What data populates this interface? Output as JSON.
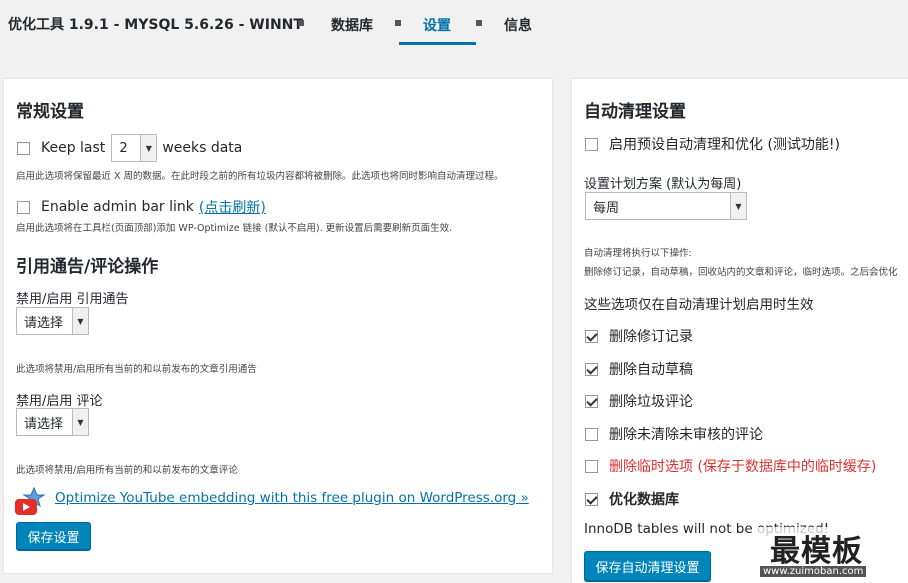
{
  "header": {
    "app_title": "优化工具 1.9.1 - MYSQL 5.6.26 - WINNT",
    "tabs": [
      {
        "label": "数据库",
        "active": false
      },
      {
        "label": "设置",
        "active": true
      },
      {
        "label": "信息",
        "active": false
      }
    ]
  },
  "general": {
    "title": "常规设置",
    "keep_last_label": "Keep last",
    "keep_last_value": "2",
    "weeks_label": "weeks data",
    "keep_last_desc": "启用此选项将保留最近 X 周的数据。在此时段之前的所有垃圾内容都将被删除。此选项也将同时影响自动清理过程。",
    "admin_bar_label": "Enable admin bar link",
    "admin_bar_link": "(点击刷新)",
    "admin_bar_desc": "启用此选项将在工具栏(页面顶部)添加 WP-Optimize 链接 (默认不启用). 更新设置后需要刷新页面生效."
  },
  "trackbacks": {
    "title": "引用通告/评论操作",
    "trackback_label": "禁用/启用 引用通告",
    "trackback_select": "请选择",
    "trackback_desc": "此选项将禁用/启用所有当前的和以前发布的文章引用通告",
    "comments_label": "禁用/启用 评论",
    "comments_select": "请选择",
    "comments_desc": "此选项将禁用/启用所有当前的和以前发布的文章评论",
    "youtube_link": "Optimize YouTube embedding with this free plugin on WordPress.org »",
    "save_button": "保存设置"
  },
  "auto_clean": {
    "title": "自动清理设置",
    "enable_label": "启用预设自动清理和优化 (测试功能!)",
    "schedule_label": "设置计划方案 (默认为每周)",
    "schedule_value": "每周",
    "actions_desc1": "自动清理将执行以下操作:",
    "actions_desc2": "删除修订记录，自动草稿，回收站内的文章和评论，临时选项。之后会优化",
    "note": "这些选项仅在自动清理计划启用时生效",
    "options": [
      {
        "label": "删除修订记录",
        "checked": true
      },
      {
        "label": "删除自动草稿",
        "checked": true
      },
      {
        "label": "删除垃圾评论",
        "checked": true
      },
      {
        "label": "删除未清除未审核的评论",
        "checked": false
      },
      {
        "label": "删除临时选项 (保存于数据库中的临时缓存)",
        "checked": false
      },
      {
        "label": "优化数据库",
        "checked": true
      }
    ],
    "innodb_note": "InnoDB tables will not be optimized!",
    "save_button": "保存自动清理设置"
  },
  "watermark": {
    "title": "最模板",
    "subtitle": "www.zuimoban.com"
  },
  "colors": {
    "accent": "#0073aa",
    "button": "#0085ba",
    "danger": "#dc3232"
  }
}
